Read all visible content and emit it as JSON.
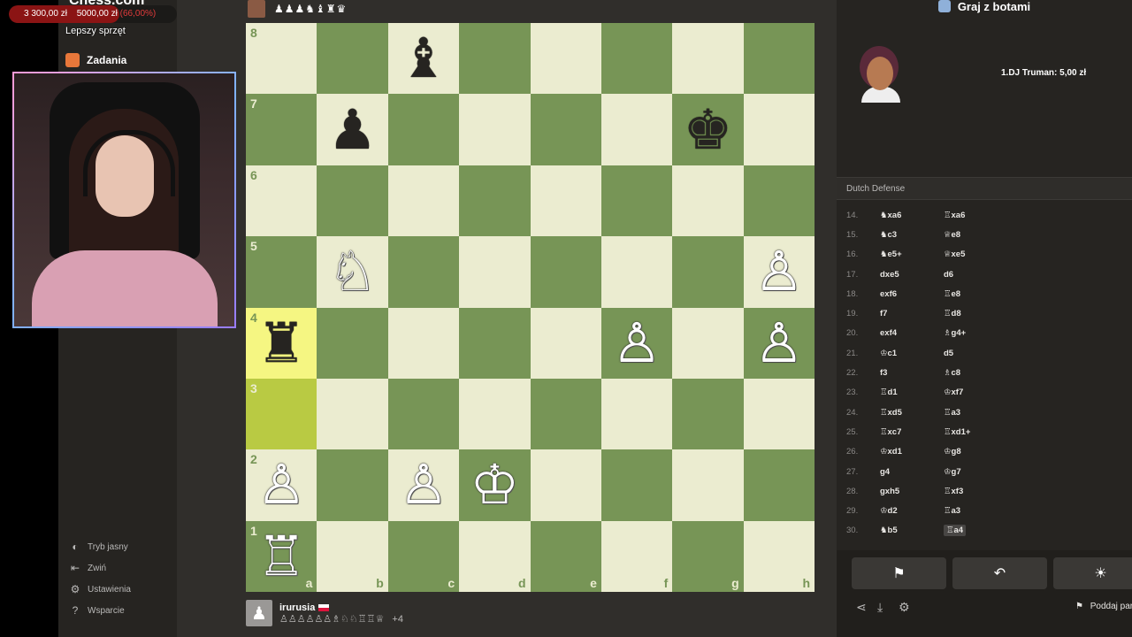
{
  "donation": {
    "current": "3 300,00 zł",
    "goal": "5000,00 zł",
    "percent": "(66,00%)",
    "progress": 0.66,
    "label": "Lepszy sprzęt"
  },
  "site_logo": "Chess.com",
  "nav": {
    "tasks": "Zadania",
    "light_mode": "Tryb jasny",
    "collapse": "Zwiń",
    "settings": "Ustawienia",
    "support": "Wsparcie"
  },
  "top_player": {
    "captured": "♟♟♟♞♝♜♛"
  },
  "board": {
    "files": [
      "a",
      "b",
      "c",
      "d",
      "e",
      "f",
      "g",
      "h"
    ],
    "ranks": [
      "8",
      "7",
      "6",
      "5",
      "4",
      "3",
      "2",
      "1"
    ],
    "highlight": [
      "a4",
      "a3"
    ],
    "pieces": {
      "c8": "♝",
      "b7": "♟",
      "g7": "♚",
      "b5": "♘",
      "h5": "♙",
      "a4": "♜",
      "f4": "♙",
      "h4": "♙",
      "a2": "♙",
      "c2": "♙",
      "d2": "♔",
      "a1": "♖"
    },
    "colors": {
      "light": "#ebecd0",
      "dark": "#779556",
      "highlight_light": "#f5f682",
      "highlight_dark": "#b9ca43"
    }
  },
  "bottom_player": {
    "name": "irurusia",
    "captured": "♙♙♙♙♙♙♗♘♘♖♖♕",
    "extra": "+4"
  },
  "panel": {
    "title": "Graj z botami",
    "overlay_ranking": "1.DJ Truman: 5,00 zł",
    "opening": "Dutch Defense",
    "moves": [
      {
        "n": "14.",
        "w": "♞xa6",
        "b": "♖xa6"
      },
      {
        "n": "15.",
        "w": "♞c3",
        "b": "♕e8"
      },
      {
        "n": "16.",
        "w": "♞e5+",
        "b": "♕xe5"
      },
      {
        "n": "17.",
        "w": "dxe5",
        "b": "d6"
      },
      {
        "n": "18.",
        "w": "exf6",
        "b": "♖e8"
      },
      {
        "n": "19.",
        "w": "f7",
        "b": "♖d8"
      },
      {
        "n": "20.",
        "w": "exf4",
        "b": "♗g4+"
      },
      {
        "n": "21.",
        "w": "♔c1",
        "b": "d5"
      },
      {
        "n": "22.",
        "w": "f3",
        "b": "♗c8"
      },
      {
        "n": "23.",
        "w": "♖d1",
        "b": "♔xf7"
      },
      {
        "n": "24.",
        "w": "♖xd5",
        "b": "♖a3"
      },
      {
        "n": "25.",
        "w": "♖xc7",
        "b": "♖xd1+"
      },
      {
        "n": "26.",
        "w": "♔xd1",
        "b": "♔g8"
      },
      {
        "n": "27.",
        "w": "g4",
        "b": "♔g7"
      },
      {
        "n": "28.",
        "w": "gxh5",
        "b": "♖xf3"
      },
      {
        "n": "29.",
        "w": "♔d2",
        "b": "♖a3"
      },
      {
        "n": "30.",
        "w": "♞b5",
        "b": "♖a4"
      }
    ],
    "resign": "Poddaj partię"
  }
}
